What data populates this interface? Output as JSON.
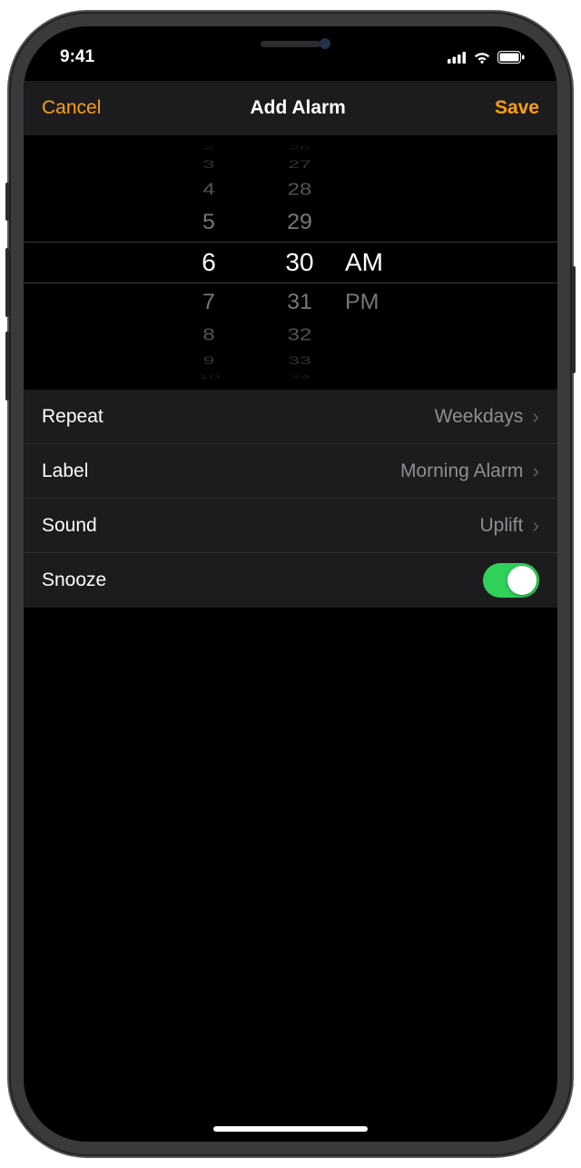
{
  "status": {
    "time": "9:41"
  },
  "nav": {
    "cancel": "Cancel",
    "title": "Add Alarm",
    "save": "Save"
  },
  "picker": {
    "hour": {
      "m4": "2",
      "m3": "3",
      "m2": "4",
      "m1": "5",
      "sel": "6",
      "p1": "7",
      "p2": "8",
      "p3": "9",
      "p4": "10"
    },
    "minute": {
      "m4": "26",
      "m3": "27",
      "m2": "28",
      "m1": "29",
      "sel": "30",
      "p1": "31",
      "p2": "32",
      "p3": "33",
      "p4": "34"
    },
    "period": {
      "sel": "AM",
      "p1": "PM"
    }
  },
  "rows": {
    "repeat": {
      "label": "Repeat",
      "value": "Weekdays"
    },
    "label": {
      "label": "Label",
      "value": "Morning Alarm"
    },
    "sound": {
      "label": "Sound",
      "value": "Uplift"
    },
    "snooze": {
      "label": "Snooze",
      "on": true
    }
  },
  "colors": {
    "accent": "#ff9f0a",
    "toggleOn": "#30d158"
  }
}
